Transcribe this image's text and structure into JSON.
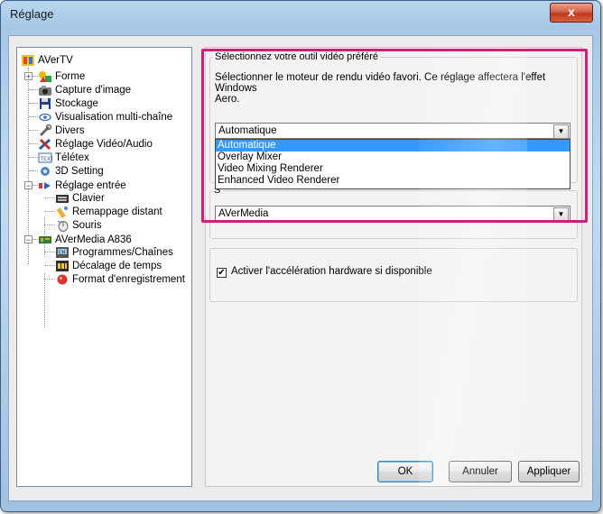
{
  "window": {
    "title": "Réglage",
    "close_glyph": "x"
  },
  "tree": {
    "root": "AVerTV",
    "items": [
      {
        "label": "Forme",
        "icon": "forme-icon"
      },
      {
        "label": "Capture d'image",
        "icon": "camera-icon"
      },
      {
        "label": "Stockage",
        "icon": "disk-icon"
      },
      {
        "label": "Visualisation multi-chaîne",
        "icon": "eye-icon"
      },
      {
        "label": "Divers",
        "icon": "wrench-icon"
      },
      {
        "label": "Réglage Vidéo/Audio",
        "icon": "tools-icon"
      },
      {
        "label": "Télétex",
        "icon": "teletext-icon"
      },
      {
        "label": "3D Setting",
        "icon": "gear-3d-icon"
      },
      {
        "label": "Réglage entrée",
        "icon": "input-icon"
      },
      {
        "label": "Clavier",
        "icon": "keyboard-icon"
      },
      {
        "label": "Remappage distant",
        "icon": "remote-icon"
      },
      {
        "label": "Souris",
        "icon": "mouse-icon"
      },
      {
        "label": "AVerMedia A836",
        "icon": "device-icon"
      },
      {
        "label": "Programmes/Chaînes",
        "icon": "channels-icon"
      },
      {
        "label": "Décalage de temps",
        "icon": "timeshift-icon"
      },
      {
        "label": "Format d'enregistrement",
        "icon": "record-icon"
      }
    ]
  },
  "video_tool": {
    "legend": "Sélectionnez votre outil vidéo préféré",
    "description_line1": "Sélectionner le moteur de rendu vidéo favori. Ce réglage affectera l'effet Windows",
    "description_line2": "Aero.",
    "selected": "Automatique",
    "options": [
      "Automatique",
      "Overlay Mixer",
      "Video Mixing Renderer",
      "Enhanced Video Renderer"
    ]
  },
  "second_group": {
    "legend_fragment": "S",
    "selected": "AVerMedia"
  },
  "hardware": {
    "checkbox_label": "Activer l'accélération hardware si disponible",
    "checked": "✔"
  },
  "buttons": {
    "ok": "OK",
    "cancel": "Annuler",
    "apply": "Appliquer"
  },
  "colors": {
    "highlight": "#d81b7a",
    "selection": "#3399ff",
    "close": "#c0391f"
  }
}
